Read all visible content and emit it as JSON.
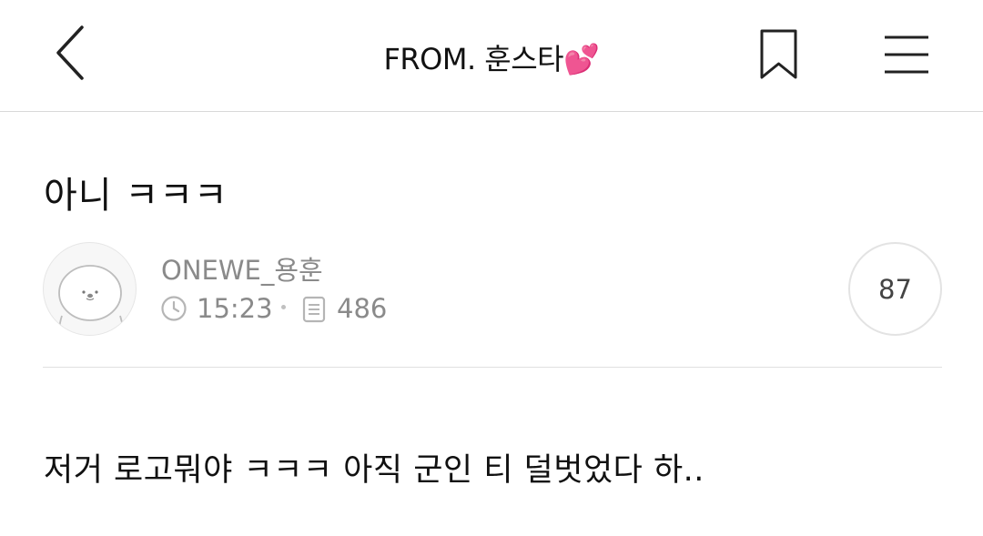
{
  "header": {
    "title": "FROM. 훈스타",
    "title_emoji": "💕",
    "back_icon": "chevron-left-icon",
    "bookmark_icon": "bookmark-icon",
    "menu_icon": "hamburger-menu-icon"
  },
  "post": {
    "title": "아니 ㅋㅋㅋ",
    "author": "ONEWE_용훈",
    "time": "15:23",
    "views": "486",
    "comment_count": "87",
    "body": "저거 로고뭐야 ㅋㅋㅋ 아직 군인 티 덜벗었다 하.."
  },
  "colors": {
    "text_primary": "#111111",
    "text_secondary": "#8a8a8a",
    "divider": "#e0e0e0",
    "heart": "#f0358a"
  }
}
